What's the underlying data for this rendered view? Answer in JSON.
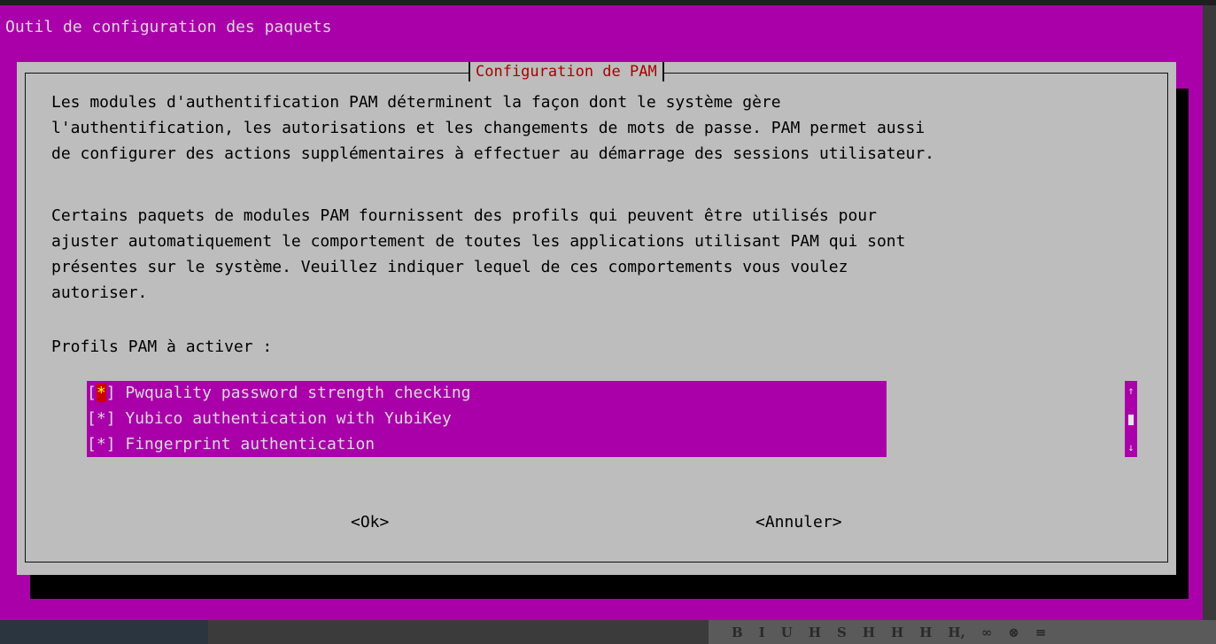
{
  "terminal": {
    "title": "Outil de configuration des paquets"
  },
  "dialog": {
    "title": "Configuration de PAM",
    "paragraph1": "Les modules d'authentification PAM déterminent la façon dont le système gère\nl'authentification, les autorisations et les changements de mots de passe. PAM permet aussi\nde configurer des actions supplémentaires à effectuer au démarrage des sessions utilisateur.",
    "paragraph2": "Certains paquets de modules PAM fournissent des profils qui peuvent être utilisés pour\najuster automatiquement le comportement de toutes les applications utilisant PAM qui sont\nprésentes sur le système. Veuillez indiquer lequel de ces comportements vous voulez\nautoriser.",
    "prompt": "Profils PAM à activer :",
    "items": [
      {
        "open": "[",
        "mark": "*",
        "close": "]",
        "label": " Pwquality password strength checking",
        "checked": true,
        "focused": true
      },
      {
        "open": "[",
        "mark": "*",
        "close": "]",
        "label": " Yubico authentication with YubiKey",
        "checked": true,
        "focused": false
      },
      {
        "open": "[",
        "mark": "*",
        "close": "]",
        "label": " Fingerprint authentication",
        "checked": true,
        "focused": false
      }
    ],
    "scroll": {
      "up": "↑",
      "down": "↓"
    },
    "buttons": {
      "ok": "<Ok>",
      "cancel": "<Annuler>"
    }
  },
  "toolbar": {
    "items": [
      "B",
      "I",
      "U",
      "H",
      "S",
      "H",
      "H",
      "H",
      "H,",
      "∞",
      "⊗",
      "≡"
    ]
  },
  "colors": {
    "terminal_bg": "#aa00aa",
    "dialog_bg": "#bdbdbd",
    "title_red": "#aa0000",
    "cursor_bg": "#cc0000",
    "cursor_fg": "#ffff00"
  }
}
